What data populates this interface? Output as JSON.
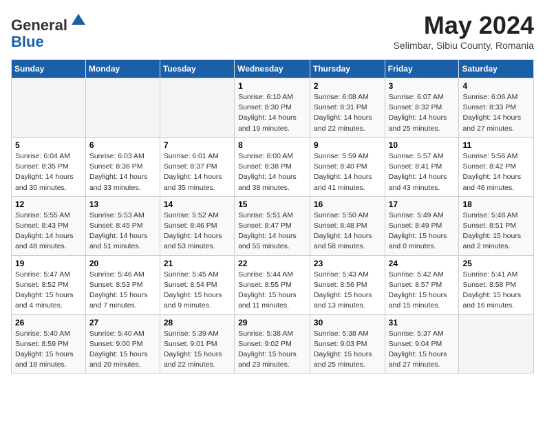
{
  "header": {
    "logo_line1": "General",
    "logo_line2": "Blue",
    "month": "May 2024",
    "location": "Selimbar, Sibiu County, Romania"
  },
  "days_of_week": [
    "Sunday",
    "Monday",
    "Tuesday",
    "Wednesday",
    "Thursday",
    "Friday",
    "Saturday"
  ],
  "weeks": [
    [
      {
        "num": "",
        "info": ""
      },
      {
        "num": "",
        "info": ""
      },
      {
        "num": "",
        "info": ""
      },
      {
        "num": "1",
        "info": "Sunrise: 6:10 AM\nSunset: 8:30 PM\nDaylight: 14 hours\nand 19 minutes."
      },
      {
        "num": "2",
        "info": "Sunrise: 6:08 AM\nSunset: 8:31 PM\nDaylight: 14 hours\nand 22 minutes."
      },
      {
        "num": "3",
        "info": "Sunrise: 6:07 AM\nSunset: 8:32 PM\nDaylight: 14 hours\nand 25 minutes."
      },
      {
        "num": "4",
        "info": "Sunrise: 6:06 AM\nSunset: 8:33 PM\nDaylight: 14 hours\nand 27 minutes."
      }
    ],
    [
      {
        "num": "5",
        "info": "Sunrise: 6:04 AM\nSunset: 8:35 PM\nDaylight: 14 hours\nand 30 minutes."
      },
      {
        "num": "6",
        "info": "Sunrise: 6:03 AM\nSunset: 8:36 PM\nDaylight: 14 hours\nand 33 minutes."
      },
      {
        "num": "7",
        "info": "Sunrise: 6:01 AM\nSunset: 8:37 PM\nDaylight: 14 hours\nand 35 minutes."
      },
      {
        "num": "8",
        "info": "Sunrise: 6:00 AM\nSunset: 8:38 PM\nDaylight: 14 hours\nand 38 minutes."
      },
      {
        "num": "9",
        "info": "Sunrise: 5:59 AM\nSunset: 8:40 PM\nDaylight: 14 hours\nand 41 minutes."
      },
      {
        "num": "10",
        "info": "Sunrise: 5:57 AM\nSunset: 8:41 PM\nDaylight: 14 hours\nand 43 minutes."
      },
      {
        "num": "11",
        "info": "Sunrise: 5:56 AM\nSunset: 8:42 PM\nDaylight: 14 hours\nand 46 minutes."
      }
    ],
    [
      {
        "num": "12",
        "info": "Sunrise: 5:55 AM\nSunset: 8:43 PM\nDaylight: 14 hours\nand 48 minutes."
      },
      {
        "num": "13",
        "info": "Sunrise: 5:53 AM\nSunset: 8:45 PM\nDaylight: 14 hours\nand 51 minutes."
      },
      {
        "num": "14",
        "info": "Sunrise: 5:52 AM\nSunset: 8:46 PM\nDaylight: 14 hours\nand 53 minutes."
      },
      {
        "num": "15",
        "info": "Sunrise: 5:51 AM\nSunset: 8:47 PM\nDaylight: 14 hours\nand 55 minutes."
      },
      {
        "num": "16",
        "info": "Sunrise: 5:50 AM\nSunset: 8:48 PM\nDaylight: 14 hours\nand 58 minutes."
      },
      {
        "num": "17",
        "info": "Sunrise: 5:49 AM\nSunset: 8:49 PM\nDaylight: 15 hours\nand 0 minutes."
      },
      {
        "num": "18",
        "info": "Sunrise: 5:48 AM\nSunset: 8:51 PM\nDaylight: 15 hours\nand 2 minutes."
      }
    ],
    [
      {
        "num": "19",
        "info": "Sunrise: 5:47 AM\nSunset: 8:52 PM\nDaylight: 15 hours\nand 4 minutes."
      },
      {
        "num": "20",
        "info": "Sunrise: 5:46 AM\nSunset: 8:53 PM\nDaylight: 15 hours\nand 7 minutes."
      },
      {
        "num": "21",
        "info": "Sunrise: 5:45 AM\nSunset: 8:54 PM\nDaylight: 15 hours\nand 9 minutes."
      },
      {
        "num": "22",
        "info": "Sunrise: 5:44 AM\nSunset: 8:55 PM\nDaylight: 15 hours\nand 11 minutes."
      },
      {
        "num": "23",
        "info": "Sunrise: 5:43 AM\nSunset: 8:56 PM\nDaylight: 15 hours\nand 13 minutes."
      },
      {
        "num": "24",
        "info": "Sunrise: 5:42 AM\nSunset: 8:57 PM\nDaylight: 15 hours\nand 15 minutes."
      },
      {
        "num": "25",
        "info": "Sunrise: 5:41 AM\nSunset: 8:58 PM\nDaylight: 15 hours\nand 16 minutes."
      }
    ],
    [
      {
        "num": "26",
        "info": "Sunrise: 5:40 AM\nSunset: 8:59 PM\nDaylight: 15 hours\nand 18 minutes."
      },
      {
        "num": "27",
        "info": "Sunrise: 5:40 AM\nSunset: 9:00 PM\nDaylight: 15 hours\nand 20 minutes."
      },
      {
        "num": "28",
        "info": "Sunrise: 5:39 AM\nSunset: 9:01 PM\nDaylight: 15 hours\nand 22 minutes."
      },
      {
        "num": "29",
        "info": "Sunrise: 5:38 AM\nSunset: 9:02 PM\nDaylight: 15 hours\nand 23 minutes."
      },
      {
        "num": "30",
        "info": "Sunrise: 5:38 AM\nSunset: 9:03 PM\nDaylight: 15 hours\nand 25 minutes."
      },
      {
        "num": "31",
        "info": "Sunrise: 5:37 AM\nSunset: 9:04 PM\nDaylight: 15 hours\nand 27 minutes."
      },
      {
        "num": "",
        "info": ""
      }
    ]
  ]
}
